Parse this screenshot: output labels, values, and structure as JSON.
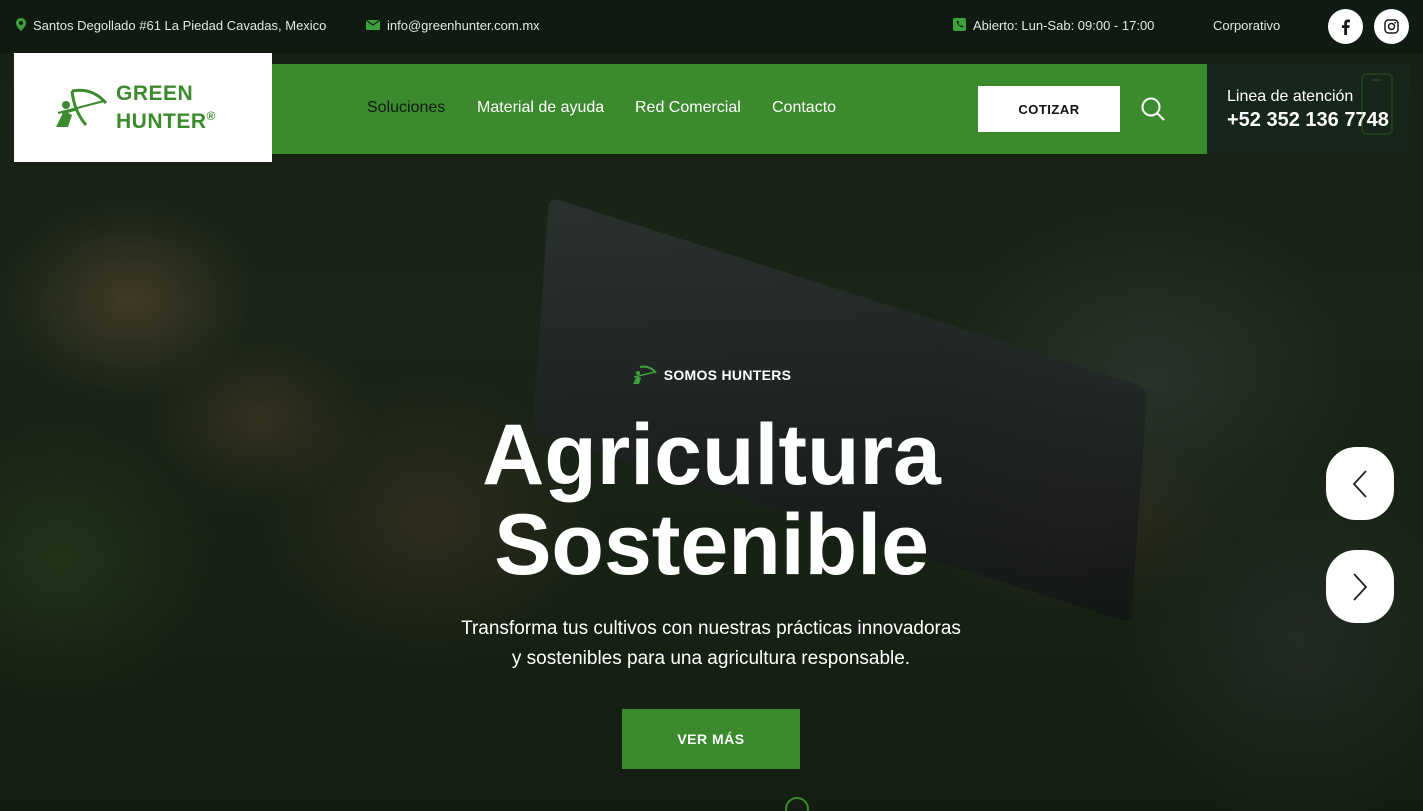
{
  "topbar": {
    "address": "Santos Degollado #61 La Piedad Cavadas, Mexico",
    "email": "info@greenhunter.com.mx",
    "hours": "Abierto: Lun-Sab: 09:00 - 17:00",
    "corporate": "Corporativo",
    "social": [
      "facebook-icon",
      "instagram-icon"
    ]
  },
  "logo": {
    "line1": "GREEN",
    "line2": "HUNTER",
    "mark": "®"
  },
  "nav": {
    "items": [
      "Soluciones",
      "Material de ayuda",
      "Red Comercial",
      "Contacto"
    ],
    "active": "Soluciones",
    "cta": "COTIZAR"
  },
  "hotline": {
    "label": "Linea de atención",
    "number": "+52 352 136 7748"
  },
  "hero": {
    "eyebrow": "SOMOS HUNTERS",
    "title_line1": "Agricultura",
    "title_line2": "Sostenible",
    "subtitle_line1": "Transforma tus cultivos con nuestras prácticas innovadoras",
    "subtitle_line2": "y sostenibles para una agricultura responsable.",
    "cta": "VER MÁS"
  },
  "colors": {
    "brand_green": "#3c8a2e",
    "dark": "#0f1b10",
    "icon_green": "#3ea03a"
  }
}
